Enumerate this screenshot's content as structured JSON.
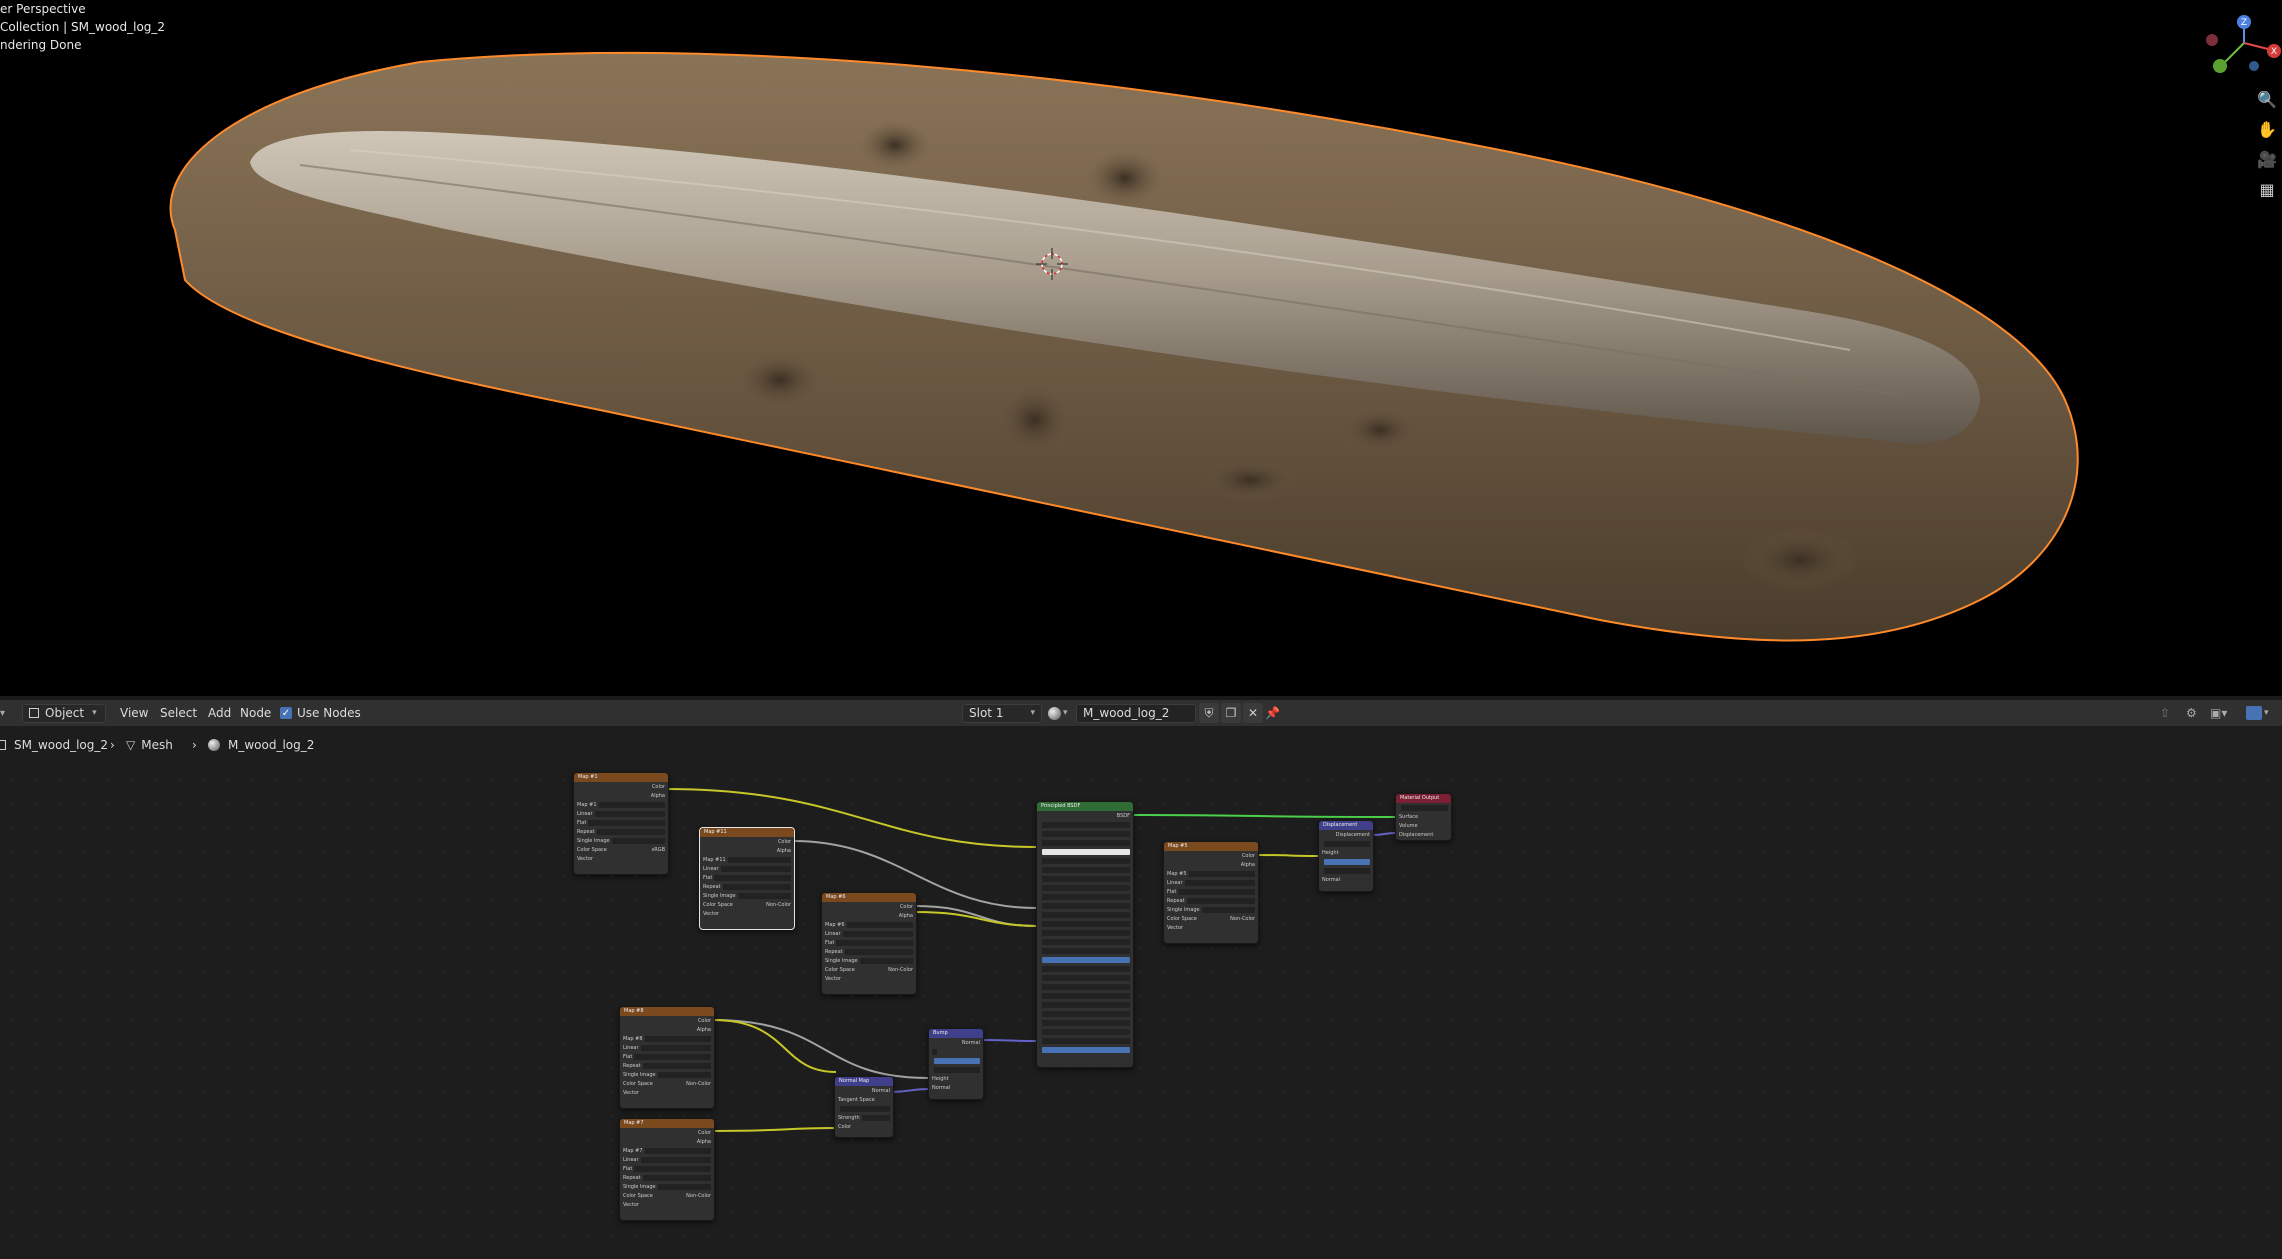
{
  "viewport": {
    "overlay_lines": [
      "er Perspective",
      "Collection | SM_wood_log_2",
      "ndering Done"
    ],
    "gizmo_axes": {
      "z": "Z",
      "x": "X",
      "y": "Y"
    }
  },
  "header": {
    "editor_icon": "shader-editor-icon",
    "mode_label": "Object",
    "menu": [
      "View",
      "Select",
      "Add",
      "Node"
    ],
    "use_nodes_label": "Use Nodes",
    "use_nodes_checked": true,
    "slot_label": "Slot 1",
    "material_name": "M_wood_log_2"
  },
  "breadcrumb": {
    "object": "SM_wood_log_2",
    "data": "Mesh",
    "material": "M_wood_log_2"
  },
  "nodes": {
    "map1": {
      "title": "Map #1",
      "image": "Map #1"
    },
    "map11": {
      "title": "Map #11",
      "image": "Map #11"
    },
    "map6": {
      "title": "Map #6",
      "image": "Map #6"
    },
    "map8": {
      "title": "Map #8",
      "image": "Map #8"
    },
    "map7": {
      "title": "Map #7",
      "image": "Map #7"
    },
    "map5": {
      "title": "Map #5",
      "image": "Map #5"
    },
    "bsdf": {
      "title": "Principled BSDF"
    },
    "bump": {
      "title": "Bump"
    },
    "normalmap": {
      "title": "Normal Map"
    },
    "displacement": {
      "title": "Displacement"
    },
    "output": {
      "title": "Material Output"
    }
  },
  "node_labels": {
    "color": "Color",
    "alpha": "Alpha",
    "linear": "Linear",
    "flat": "Flat",
    "repeat": "Repeat",
    "single_image": "Single Image",
    "color_space": "Color Space",
    "srgb": "sRGB",
    "noncolor": "Non-Color",
    "vector": "Vector",
    "bsdf": "BSDF",
    "normal": "Normal",
    "height": "Height",
    "displacement": "Displacement",
    "surface": "Surface",
    "volume": "Volume",
    "tangent_space": "Tangent Space",
    "strength": "Strength"
  },
  "colors": {
    "image_header": "#7a4a1e",
    "shader_header": "#2f6b34",
    "vector_header": "#3f3f8c",
    "output_header": "#7a1f34",
    "link_yellow": "#c7c729",
    "link_gray": "#a3a3a3",
    "link_green": "#4bd04b",
    "link_purple": "#6363c7",
    "selection_outline": "#ff8a2a"
  }
}
